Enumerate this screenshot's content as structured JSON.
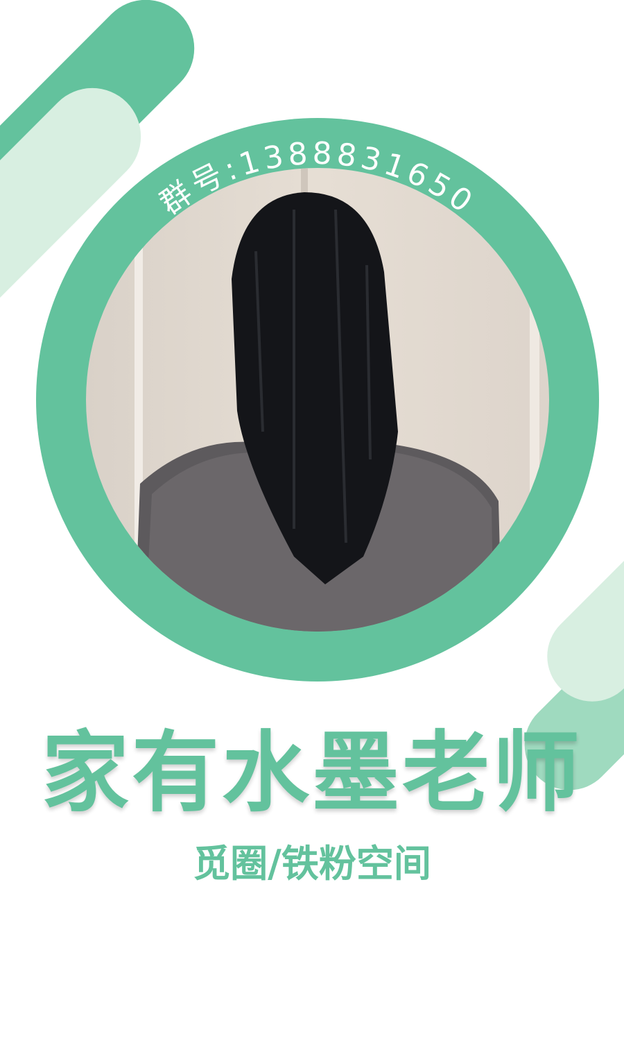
{
  "group_label": "群号:1388831650",
  "title": "家有水墨老师",
  "subtitle": "觅圈/铁粉空间",
  "colors": {
    "accent": "#63c29d",
    "light_accent": "#d8efe1"
  }
}
